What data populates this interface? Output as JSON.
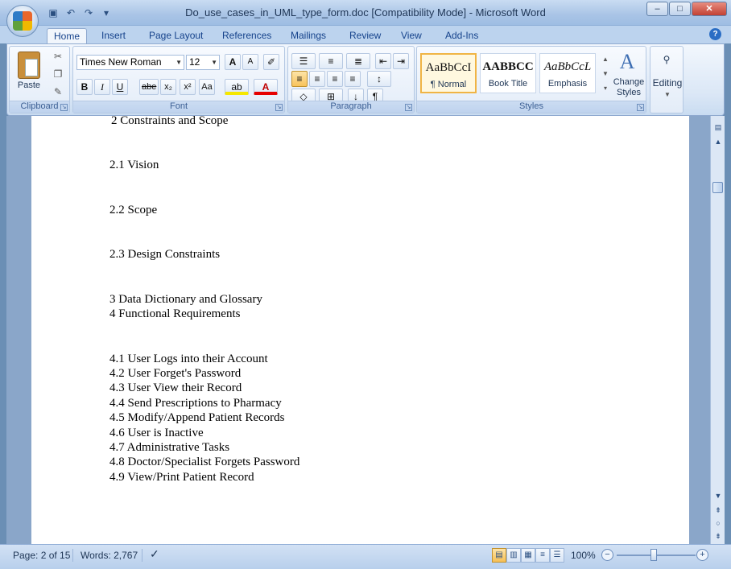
{
  "window": {
    "title": "Do_use_cases_in_UML_type_form.doc [Compatibility Mode] - Microsoft Word",
    "minimize": "–",
    "maximize": "□",
    "close": "✕"
  },
  "tabs": [
    "Home",
    "Insert",
    "Page Layout",
    "References",
    "Mailings",
    "Review",
    "View",
    "Add-Ins"
  ],
  "ribbon": {
    "clipboard": {
      "label": "Clipboard",
      "paste": "Paste"
    },
    "font": {
      "label": "Font",
      "family": "Times New Roman",
      "size": "12",
      "bold": "B",
      "italic": "I",
      "underline": "U",
      "strike": "abe",
      "subscript": "x₂",
      "superscript": "x²",
      "change_case": "Aa",
      "grow": "A",
      "shrink": "A"
    },
    "paragraph": {
      "label": "Paragraph"
    },
    "styles": {
      "label": "Styles",
      "items": [
        {
          "sample": "AaBbCcI",
          "name": "¶ Normal"
        },
        {
          "sample": "AABBCC",
          "name": "Book Title"
        },
        {
          "sample": "AaBbCcL",
          "name": "Emphasis"
        }
      ],
      "change_styles": "Change Styles"
    },
    "editing": {
      "label": "Editing"
    }
  },
  "document": {
    "lines": [
      "2 Constraints and Scope",
      "2.1 Vision",
      "2.2 Scope",
      "2.3 Design Constraints",
      "3 Data Dictionary and Glossary",
      "4 Functional Requirements",
      "4.1 User Logs into their Account",
      "4.2 User Forget's Password",
      "4.3 User View their Record",
      "4.4 Send Prescriptions to Pharmacy",
      "4.5 Modify/Append Patient Records",
      "4.6 User is Inactive",
      "4.7 Administrative Tasks",
      "4.8 Doctor/Specialist Forgets Password",
      "4.9 View/Print Patient Record"
    ]
  },
  "status": {
    "page": "Page: 2 of 15",
    "words": "Words: 2,767",
    "zoom": "100%"
  },
  "colors": {
    "ribbon_bg": "#dbe7f6",
    "tab_text": "#15428b",
    "selected": "#f8c35c"
  }
}
